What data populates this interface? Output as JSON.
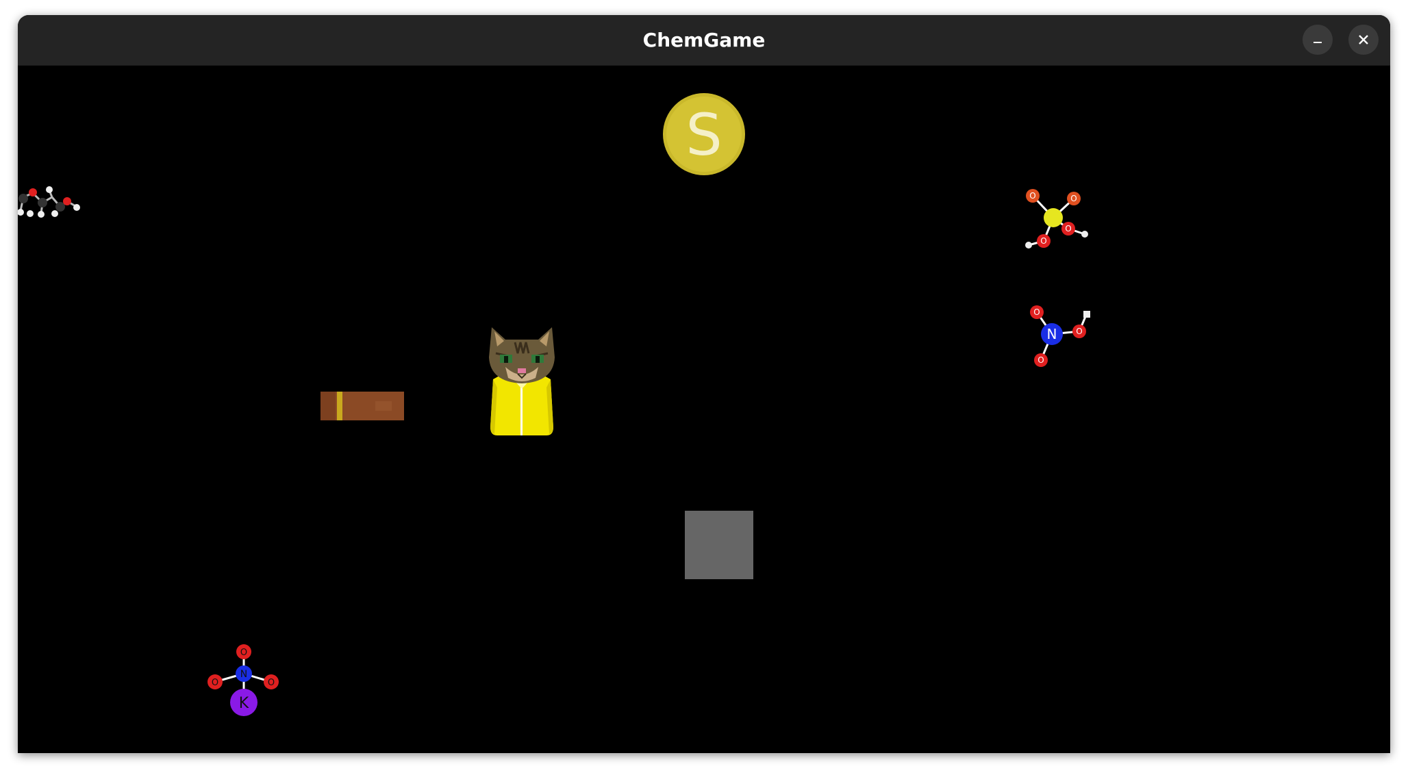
{
  "window": {
    "title": "ChemGame",
    "minimize_icon": "minimize-icon",
    "close_icon": "close-icon"
  },
  "game": {
    "background_color": "#000000",
    "coin": {
      "label": "S",
      "color": "#d4c333",
      "text_color": "#f5f0c8"
    },
    "player": {
      "sprite": "cat-in-yellow-jacket",
      "jacket_color": "#f2e600"
    },
    "platform_color": "#8b4a25",
    "block_color": "#666666",
    "molecules": [
      {
        "name": "propylene-glycol",
        "atom_labels": []
      },
      {
        "name": "sulfuric-acid",
        "atom_labels": [
          "O",
          "O",
          "O",
          "O"
        ]
      },
      {
        "name": "nitric-acid",
        "atom_labels": [
          "N",
          "O",
          "O",
          "O"
        ]
      },
      {
        "name": "potassium-nitrate",
        "atom_labels": [
          "N",
          "O",
          "O",
          "O",
          "K"
        ]
      }
    ]
  }
}
